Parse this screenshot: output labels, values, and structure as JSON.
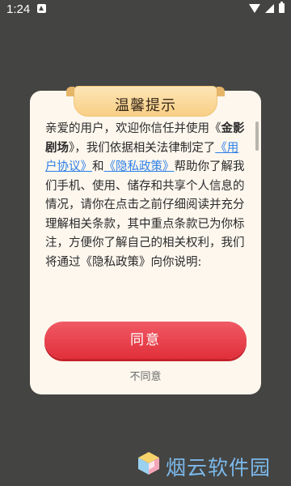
{
  "status_bar": {
    "time": "1:24",
    "icons": [
      "notification-icon",
      "wifi-icon",
      "signal-icon",
      "battery-icon"
    ]
  },
  "dialog": {
    "title": "温馨提示",
    "body": {
      "seg1": "亲爱的用户，欢迎你信任并使用《",
      "app_name": "金影剧场",
      "seg2": "》，我们依据相关法律制定了",
      "link_user_agreement": "《用户协议》",
      "seg3": "和",
      "link_privacy_policy": "《隐私政策》",
      "seg4": "帮助你了解我们手机、使用、储存和共享个人信息的情况，请你在点击之前仔细阅读并充分理解相关条款，其中重点条款已为你标注，方便你了解自己的相关权利，我们将通过《隐私政策》向你说明:"
    },
    "agree_label": "同意",
    "disagree_label": "不同意"
  },
  "watermark": {
    "text": "烟云软件园"
  },
  "colors": {
    "background": "#444442",
    "dialog_bg": "#fdf7ee",
    "title_tab": "#f8cf85",
    "link": "#2d7fe8",
    "agree_button": "#e12f3b",
    "watermark": "#7bb8ea"
  }
}
